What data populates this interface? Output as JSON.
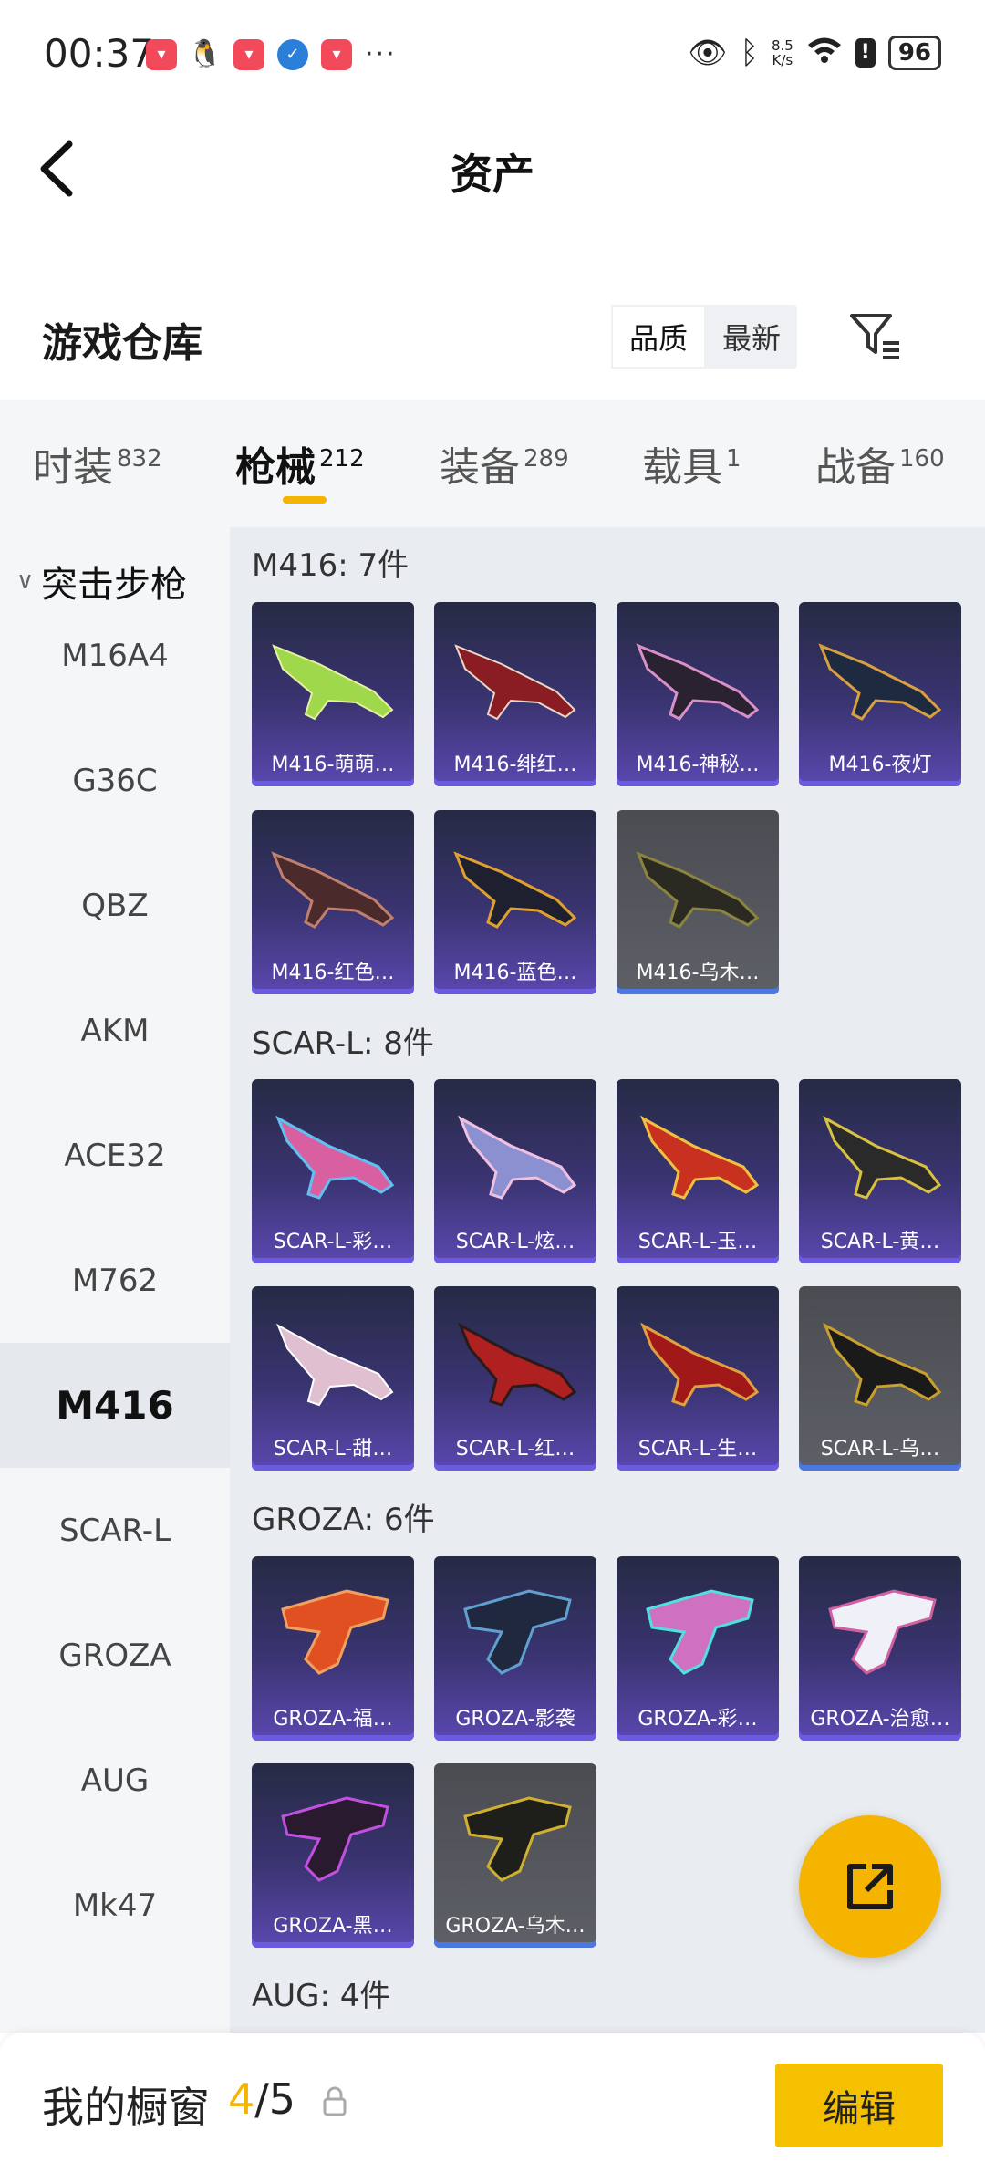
{
  "status": {
    "time": "00:37",
    "network_speed": "8.5\nK/s",
    "battery": "96"
  },
  "header": {
    "title": "资产"
  },
  "warehouse": {
    "title": "游戏仓库",
    "sort_options": [
      "品质",
      "最新"
    ]
  },
  "tabs": [
    {
      "label": "时装",
      "count": "832"
    },
    {
      "label": "枪械",
      "count": "212"
    },
    {
      "label": "装备",
      "count": "289"
    },
    {
      "label": "载具",
      "count": "1"
    },
    {
      "label": "战备",
      "count": "160"
    }
  ],
  "sidebar": {
    "group": "突击步枪",
    "items": [
      "M16A4",
      "G36C",
      "QBZ",
      "AKM",
      "ACE32",
      "M762",
      "M416",
      "SCAR-L",
      "GROZA",
      "AUG",
      "Mk47"
    ]
  },
  "groups": [
    {
      "label": "M416: 7件",
      "items": [
        "M416-萌萌…",
        "M416-绯红…",
        "M416-神秘…",
        "M416-夜灯",
        "M416-红色…",
        "M416-蓝色…",
        "M416-乌木…"
      ]
    },
    {
      "label": "SCAR-L: 8件",
      "items": [
        "SCAR-L-彩…",
        "SCAR-L-炫…",
        "SCAR-L-玉…",
        "SCAR-L-黄…",
        "SCAR-L-甜…",
        "SCAR-L-红…",
        "SCAR-L-生…",
        "SCAR-L-乌…"
      ]
    },
    {
      "label": "GROZA: 6件",
      "items": [
        "GROZA-福…",
        "GROZA-影袭",
        "GROZA-彩…",
        "GROZA-治愈…",
        "GROZA-黑…",
        "GROZA-乌木…"
      ]
    },
    {
      "label": "AUG: 4件",
      "items": []
    }
  ],
  "bottom": {
    "showcase_label": "我的橱窗",
    "used": "4",
    "total": "/5",
    "edit_label": "编辑"
  }
}
